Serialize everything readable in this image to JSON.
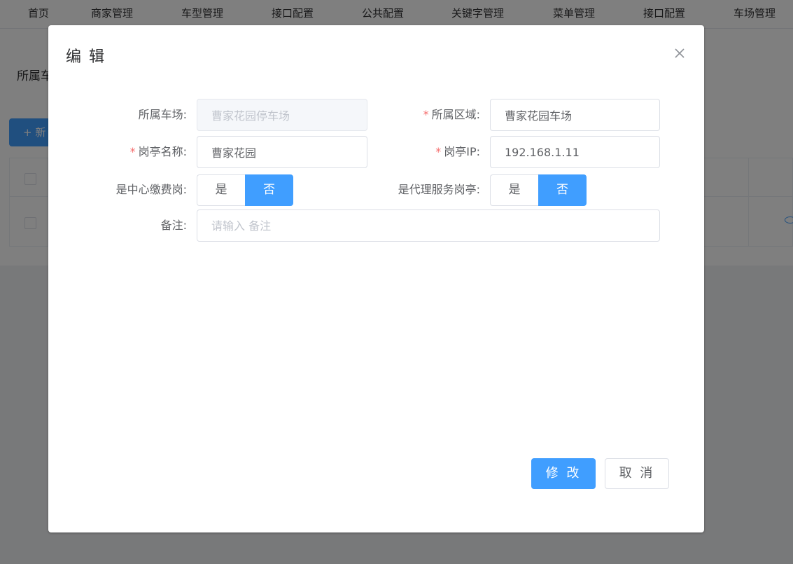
{
  "nav": {
    "items": [
      "首页",
      "商家管理",
      "车型管理",
      "接口配置",
      "公共配置",
      "关键字管理",
      "菜单管理",
      "接口配置",
      "车场管理"
    ]
  },
  "background": {
    "filter_label": "所属车",
    "add_button": "+ 新"
  },
  "dialog": {
    "title": "编 辑",
    "fields": {
      "parking_lot": {
        "label": "所属车场:",
        "value": "曹家花园停车场"
      },
      "area": {
        "label": "所属区域:",
        "value": "曹家花园车场"
      },
      "booth_name": {
        "label": "岗亭名称:",
        "value": "曹家花园"
      },
      "booth_ip": {
        "label": "岗亭IP:",
        "value": "192.168.1.11"
      },
      "central_pay": {
        "label": "是中心缴费岗:",
        "yes": "是",
        "no": "否",
        "selected": "否"
      },
      "agent_service": {
        "label": "是代理服务岗亭:",
        "yes": "是",
        "no": "否",
        "selected": "否"
      },
      "remark": {
        "label": "备注:",
        "value": "",
        "placeholder": "请输入 备注"
      }
    },
    "submit_label": "修 改",
    "cancel_label": "取 消"
  },
  "colors": {
    "primary": "#409eff",
    "required": "#f56c6c",
    "overlay": "rgba(0,0,0,0.5)"
  }
}
